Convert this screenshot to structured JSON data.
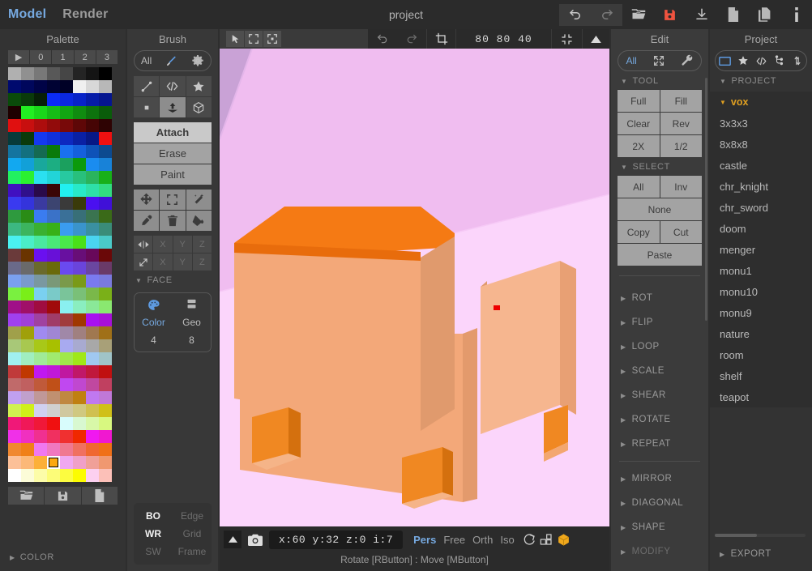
{
  "titlebar": {
    "menus": [
      {
        "label": "Model",
        "active": true
      },
      {
        "label": "Render",
        "active": false
      }
    ],
    "project_title": "project",
    "tools": [
      {
        "name": "undo-button",
        "icon": "undo-icon",
        "state": "enabled"
      },
      {
        "name": "redo-button",
        "icon": "redo-icon",
        "state": "disabled"
      },
      {
        "name": "open-button",
        "icon": "folder-open-icon",
        "state": "enabled"
      },
      {
        "name": "save-button",
        "icon": "floppy-save-icon",
        "state": "accent"
      },
      {
        "name": "download-button",
        "icon": "download-icon",
        "state": "enabled"
      },
      {
        "name": "new-file-button",
        "icon": "file-icon",
        "state": "enabled"
      },
      {
        "name": "copy-file-button",
        "icon": "file-copy-icon",
        "state": "enabled"
      },
      {
        "name": "info-button",
        "icon": "info-icon",
        "state": "enabled"
      }
    ],
    "accent_color": "#f0533f"
  },
  "palette": {
    "title": "Palette",
    "tabs": [
      "▶",
      "0",
      "1",
      "2",
      "3"
    ],
    "selected_index": 243,
    "footer": [
      {
        "name": "palette-open-button",
        "icon": "folder-open-icon"
      },
      {
        "name": "palette-save-button",
        "icon": "floppy-save-icon"
      },
      {
        "name": "palette-new-button",
        "icon": "file-icon"
      }
    ],
    "color_section": {
      "label": "COLOR",
      "expanded": false
    },
    "colors": [
      "#b0b0b0",
      "#909090",
      "#787878",
      "#585858",
      "#464646",
      "#242424",
      "#141414",
      "#000000",
      "#000a6e",
      "#00075c",
      "#000347",
      "#000233",
      "#000126",
      "#f0f0f0",
      "#d8d8d8",
      "#b8b8b8",
      "#0a4b0a",
      "#0a3a0a",
      "#071f07",
      "#0b2bf5",
      "#0b28e0",
      "#0823c8",
      "#061ca8",
      "#051690",
      "#1e0000",
      "#22ee22",
      "#1ad81a",
      "#16bd16",
      "#12a512",
      "#108c10",
      "#0d730d",
      "#0a5c0a",
      "#e01010",
      "#c80f0f",
      "#ad0d0d",
      "#920b0b",
      "#780909",
      "#5e0707",
      "#460505",
      "#2e0303",
      "#073a3a",
      "#0a3a0a",
      "#1438f0",
      "#1030dc",
      "#0d28c0",
      "#0a20a4",
      "#071886",
      "#ee1010",
      "#1474a0",
      "#137080",
      "#156a52",
      "#0a7a0a",
      "#1a70f0",
      "#1560dc",
      "#0e52b8",
      "#0c4a90",
      "#12a8f0",
      "#12a0d8",
      "#19a89c",
      "#1cae82",
      "#1ba05e",
      "#0c9a0c",
      "#1a8cf0",
      "#1882d8",
      "#22f060",
      "#2bf030",
      "#2ae0f0",
      "#22d4d8",
      "#27c9a0",
      "#28c07c",
      "#2ab45c",
      "#18b018",
      "#4010c0",
      "#30108c",
      "#2a0a4a",
      "#3a0606",
      "#22f0f0",
      "#28eac8",
      "#2ee0a8",
      "#32dc80",
      "#3a3af0",
      "#3434dc",
      "#3a3aa0",
      "#3c4470",
      "#3a3a3a",
      "#3a3a0a",
      "#4a10f0",
      "#4010d8",
      "#2e9a3e",
      "#2a8c16",
      "#3a7cf0",
      "#3a72c8",
      "#3a7098",
      "#386f78",
      "#3a7450",
      "#3a6a18",
      "#3cb882",
      "#3cb45e",
      "#3ab030",
      "#38b018",
      "#3a9cf0",
      "#3a94cc",
      "#3a90a0",
      "#3a8c78",
      "#4af0f0",
      "#4aeec8",
      "#4ae8a0",
      "#4ae878",
      "#4ae84a",
      "#4ae018",
      "#4ad4f0",
      "#4acac8",
      "#6a3a3a",
      "#6a3400",
      "#6a10f0",
      "#6810d8",
      "#6810a0",
      "#680e78",
      "#68085a",
      "#6a0808",
      "#6a6a8a",
      "#6a6a6a",
      "#6a6a2a",
      "#6a6a0a",
      "#6a4af0",
      "#6a44dc",
      "#6a46a0",
      "#6a3a68",
      "#7aa0f0",
      "#7a9acc",
      "#7a98a0",
      "#7a9878",
      "#7a9a4a",
      "#7a9a18",
      "#7a7af0",
      "#7a7ade",
      "#7af040",
      "#7aee18",
      "#7ad0f0",
      "#7acac8",
      "#7ac49a",
      "#7ac078",
      "#7ab84a",
      "#7ab018",
      "#a01088",
      "#a01068",
      "#a00c40",
      "#a00a0a",
      "#8af0f0",
      "#8aeec0",
      "#8ae898",
      "#8ae870",
      "#a040f0",
      "#a040d8",
      "#a042a0",
      "#a03c68",
      "#a03c3c",
      "#a03800",
      "#a810f0",
      "#a810d8",
      "#a0a04a",
      "#a0a00a",
      "#a08af0",
      "#a086d4",
      "#a088a8",
      "#a08080",
      "#a07850",
      "#a07018",
      "#a8c878",
      "#a8c850",
      "#a8c818",
      "#a8c000",
      "#a8aaf0",
      "#a8aad0",
      "#a8a8a8",
      "#a8a078",
      "#a0f0f0",
      "#a0eec0",
      "#a0ea98",
      "#a0ea70",
      "#a0e84a",
      "#a0e818",
      "#a0c8f0",
      "#a0c4c8",
      "#c03a3a",
      "#c03800",
      "#c018f0",
      "#c018d8",
      "#c018a0",
      "#c01868",
      "#c0183c",
      "#c01010",
      "#c06a6a",
      "#c06060",
      "#c05a3a",
      "#c05018",
      "#c048f0",
      "#c048d0",
      "#c048a0",
      "#c04060",
      "#c0a0f0",
      "#c0a0cc",
      "#c09898",
      "#c09070",
      "#c08840",
      "#c08010",
      "#c078f0",
      "#c078d8",
      "#d0f050",
      "#d0f018",
      "#d0d0f0",
      "#d0d0d0",
      "#d0c8a0",
      "#d0c880",
      "#d0c050",
      "#d0c018",
      "#f01878",
      "#f01858",
      "#f01838",
      "#f01010",
      "#d8fcfc",
      "#d8f8d0",
      "#d8f8a8",
      "#d8f880",
      "#f030e8",
      "#f030c0",
      "#f03090",
      "#f03060",
      "#f03030",
      "#f02800",
      "#f018f0",
      "#f018d0",
      "#f08830",
      "#f08018",
      "#f078f0",
      "#f078c0",
      "#f07890",
      "#f07060",
      "#f06830",
      "#f07018",
      "#fcc098",
      "#fcb878",
      "#fcb038",
      "#fca810",
      "#f0a8f0",
      "#f0a0c8",
      "#f0a098",
      "#f09870",
      "#ffffff",
      "#fcfcd8",
      "#fcfca8",
      "#fcfc78",
      "#fcfc40",
      "#fcfc00",
      "#fcd0f0",
      "#fcc0b8"
    ]
  },
  "brush": {
    "title": "Brush",
    "mode_pill": {
      "all_label": "All",
      "brush_icon": "paintbrush-icon",
      "settings_icon": "gear-icon"
    },
    "shapes_row1": [
      {
        "name": "line-brush",
        "icon": "line-icon",
        "active": false
      },
      {
        "name": "pattern-brush",
        "icon": "code-brackets-icon",
        "active": false
      },
      {
        "name": "star-brush",
        "icon": "star-icon",
        "active": false
      }
    ],
    "shapes_row2": [
      {
        "name": "voxel-brush",
        "icon": "square-dot-icon",
        "active": false
      },
      {
        "name": "center-brush",
        "icon": "up-arrow-plate-icon",
        "active": true
      },
      {
        "name": "box-brush",
        "icon": "cube-icon",
        "active": false
      }
    ],
    "actions": [
      {
        "label": "Attach",
        "selected": true
      },
      {
        "label": "Erase",
        "selected": false
      },
      {
        "label": "Paint",
        "selected": false
      }
    ],
    "tools_row1": [
      {
        "name": "move-tool",
        "icon": "move-arrows-icon"
      },
      {
        "name": "region-select-tool",
        "icon": "selection-brackets-icon"
      },
      {
        "name": "magic-wand-tool",
        "icon": "magic-wand-icon"
      }
    ],
    "tools_row2": [
      {
        "name": "eyedropper-tool",
        "icon": "eyedropper-icon"
      },
      {
        "name": "delete-tool",
        "icon": "trash-icon"
      },
      {
        "name": "bucket-fill-tool",
        "icon": "paint-bucket-icon"
      }
    ],
    "mirror_row1": {
      "icon": "mirror-icon",
      "axes": [
        "X",
        "Y",
        "Z"
      ]
    },
    "mirror_row2": {
      "icon": "diagonal-arrow-icon",
      "axes": [
        "X",
        "Y",
        "Z"
      ]
    },
    "face": {
      "header": "FACE",
      "color": {
        "icon": "palette-icon",
        "label": "Color",
        "value": "4",
        "active": true
      },
      "geo": {
        "icon": "layers-icon",
        "label": "Geo",
        "value": "8",
        "active": false
      }
    },
    "display_toggles": [
      [
        {
          "label": "BO",
          "on": true
        },
        {
          "label": "Edge",
          "on": false
        }
      ],
      [
        {
          "label": "WR",
          "on": true
        },
        {
          "label": "Grid",
          "on": false
        }
      ],
      [
        {
          "label": "SW",
          "on": false
        },
        {
          "label": "Frame",
          "on": false
        }
      ]
    ]
  },
  "viewport": {
    "toolbar_left": [
      {
        "name": "pointer-tool",
        "icon": "cursor-arrow-icon",
        "active": true
      },
      {
        "name": "marquee-tool",
        "icon": "marquee-icon",
        "active": false
      },
      {
        "name": "grid-select-tool",
        "icon": "grid-select-icon",
        "active": false
      }
    ],
    "toolbar_right": [
      {
        "name": "viewport-undo-button",
        "icon": "undo-icon"
      },
      {
        "name": "viewport-redo-button",
        "icon": "redo-icon"
      },
      {
        "name": "crop-button",
        "icon": "crop-icon"
      }
    ],
    "model_size": "80  80  40",
    "fit_icon": "fit-to-screen-icon",
    "collapse_icon": "triangle-up-icon",
    "status": {
      "expand_icon": "triangle-up-icon",
      "camera_icon": "camera-icon",
      "coords": "x:60   y:32   z:0     i:7",
      "projections": [
        {
          "label": "Pers",
          "active": true
        },
        {
          "label": "Free",
          "active": false
        },
        {
          "label": "Orth",
          "active": false
        },
        {
          "label": "Iso",
          "active": false
        }
      ],
      "extra_icons": [
        {
          "name": "orbit-reset-icon"
        },
        {
          "name": "view-layout-icon"
        },
        {
          "name": "render-cube-icon"
        }
      ],
      "hint": "Rotate [RButton] : Move [MButton]"
    },
    "scene": {
      "bg_color": "#f5c8f5",
      "wall_left_color": "#e0b0e8",
      "wall_back_color": "#f0bff0",
      "floor_color": "#fbd4fb",
      "model_top_color": "#f57a14",
      "model_front_color": "#f0a070",
      "model_side_color": "#f5b088",
      "cursor_marker_color": "#ee0000",
      "gizmo_fill": "#8b7f95",
      "gizmo_axis_x": "#ee0000",
      "gizmo_axis_y": "#88cc00",
      "gizmo_axis_z": "#2288dd"
    }
  },
  "edit": {
    "title": "Edit",
    "mode_pill": {
      "all_label": "All",
      "move_icon": "scatter-arrows-icon",
      "wrench_icon": "wrench-icon"
    },
    "tool_header": "TOOL",
    "tool_buttons": [
      "Full",
      "Fill",
      "Clear",
      "Rev",
      "2X",
      "1/2"
    ],
    "select_header": "SELECT",
    "select_buttons": [
      "All",
      "Inv"
    ],
    "select_none": "None",
    "clipboard_buttons": [
      "Copy",
      "Cut"
    ],
    "paste_button": "Paste",
    "collapsed_sections": [
      "ROT",
      "FLIP",
      "LOOP",
      "SCALE",
      "SHEAR",
      "ROTATE",
      "REPEAT"
    ],
    "collapsed_sections_2": [
      "MIRROR",
      "DIAGONAL",
      "SHAPE",
      "MODIFY"
    ]
  },
  "project": {
    "title": "Project",
    "toolbar": [
      {
        "name": "project-folder-button",
        "icon": "folder-outline-icon",
        "active": true
      },
      {
        "name": "project-favorite-button",
        "icon": "star-icon",
        "active": false
      },
      {
        "name": "project-code-button",
        "icon": "code-brackets-icon",
        "active": false
      },
      {
        "name": "project-tree-button",
        "icon": "tree-node-icon",
        "active": false
      },
      {
        "name": "project-sort-button",
        "icon": "sort-updown-icon",
        "active": false
      }
    ],
    "header": "PROJECT",
    "root": "vox",
    "items": [
      "3x3x3",
      "8x8x8",
      "castle",
      "chr_knight",
      "chr_sword",
      "doom",
      "menger",
      "monu1",
      "monu10",
      "monu9",
      "nature",
      "room",
      "shelf",
      "teapot"
    ],
    "export_header": "EXPORT"
  }
}
